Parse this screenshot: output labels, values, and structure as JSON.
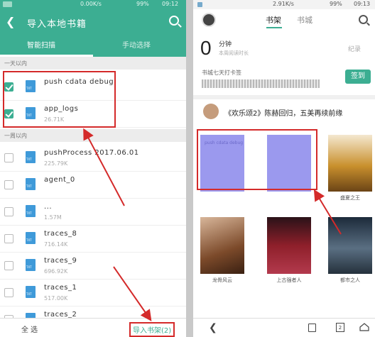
{
  "left_phone": {
    "status": {
      "net": "0.00K/s",
      "battery": "99%",
      "time": "09:12"
    },
    "title": "导入本地书籍",
    "tabs": [
      "智能扫描",
      "手动选择"
    ],
    "section_recent": "一天以内",
    "section_week": "一周以内",
    "recent_files": [
      {
        "name": "push cdata debug",
        "size": "",
        "checked": true
      },
      {
        "name": "app_logs",
        "size": "26.71K",
        "checked": true
      }
    ],
    "week_files": [
      {
        "name": "pushProcess 2017.06.01",
        "size": "225.79K"
      },
      {
        "name": "agent_0",
        "size": ""
      },
      {
        "name": "...",
        "size": "1.57M"
      },
      {
        "name": "traces_8",
        "size": "716.14K"
      },
      {
        "name": "traces_9",
        "size": "696.92K"
      },
      {
        "name": "traces_1",
        "size": "517.00K"
      },
      {
        "name": "traces_2",
        "size": ""
      }
    ],
    "bottom": {
      "select_all": "全选",
      "import_btn": "导入书架(2)"
    }
  },
  "right_phone": {
    "status": {
      "net": "2.91K/s",
      "battery": "99%",
      "time": "09:13"
    },
    "tabs": [
      "书架",
      "书城"
    ],
    "reading": {
      "minutes": "0",
      "unit": "分钟",
      "sub": "本周阅读时长",
      "tag": "纪录"
    },
    "checkin": {
      "label": "书城七天打卡签",
      "button": "签到"
    },
    "news": "《欢乐颂2》陈赫回归，五美再续前缘",
    "books": [
      {
        "title": "",
        "cover_text": "push cdata debug"
      },
      {
        "title": "",
        "cover_text": ""
      },
      {
        "title": "盛夏之王",
        "cover_text": ""
      },
      {
        "title": "龙骨风云",
        "cover_text": ""
      },
      {
        "title": "上古强者人",
        "cover_text": ""
      },
      {
        "title": "都市之人",
        "cover_text": ""
      }
    ]
  },
  "colors": {
    "accent": "#3cae92",
    "highlight": "#d42a2a",
    "imported_cover": "#9b99ee"
  }
}
